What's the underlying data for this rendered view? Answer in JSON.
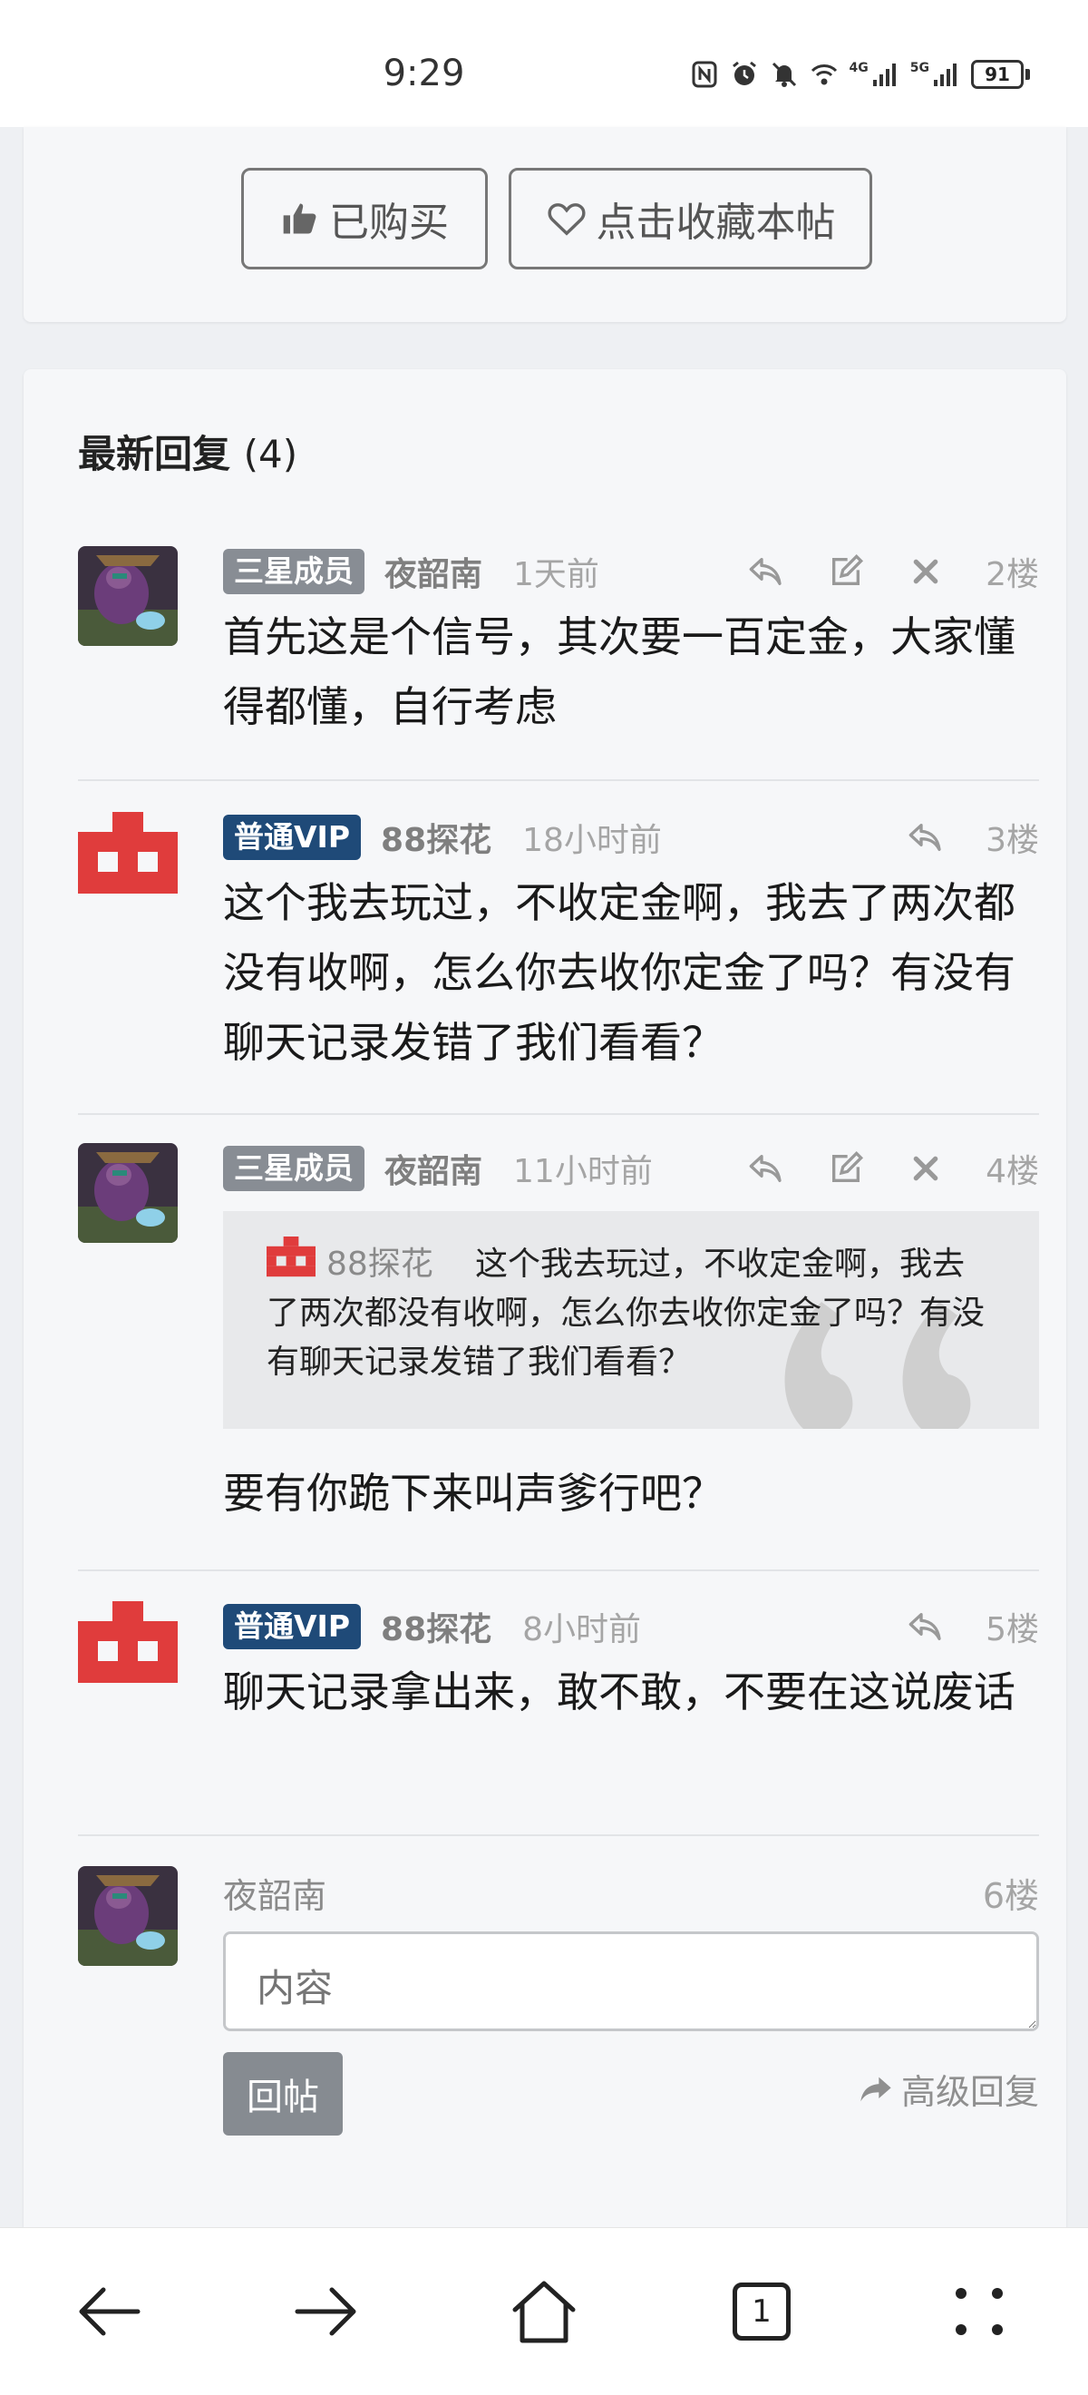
{
  "status_bar": {
    "time": "9:29",
    "battery": "91",
    "net_a": "4G",
    "net_b": "5G"
  },
  "top_card": {
    "bought_label": "已购买",
    "favorite_label": "点击收藏本帖"
  },
  "replies_section": {
    "title": "最新回复",
    "count": "(4)"
  },
  "posts": [
    {
      "badge": "三星成员",
      "user": "夜韶南",
      "time": "1天前",
      "floor": "2楼",
      "text": "首先这是个信号，其次要一百定金，大家懂得都懂，自行考虑"
    },
    {
      "badge": "普通VIP",
      "user": "88探花",
      "time": "18小时前",
      "floor": "3楼",
      "text": "这个我去玩过，不收定金啊，我去了两次都没有收啊，怎么你去收你定金了吗？有没有聊天记录发错了我们看看？"
    },
    {
      "badge": "三星成员",
      "user": "夜韶南",
      "time": "11小时前",
      "floor": "4楼",
      "quote_user": "88探花",
      "quote_text": "这个我去玩过，不收定金啊，我去了两次都没有收啊，怎么你去收你定金了吗？有没有聊天记录发错了我们看看？",
      "text": "要有你跪下来叫声爹行吧？"
    },
    {
      "badge": "普通VIP",
      "user": "88探花",
      "time": "8小时前",
      "floor": "5楼",
      "text": "聊天记录拿出来，敢不敢，不要在这说废话"
    }
  ],
  "reply_form": {
    "user": "夜韶南",
    "floor": "6楼",
    "placeholder": "内容",
    "submit_label": "回帖",
    "advanced_label": "高级回复"
  },
  "bottom_nav": {
    "tabs_count": "1"
  },
  "colors": {
    "badge_gray": "#888d94",
    "badge_navy": "#1f4a78",
    "vip_avatar_red": "#e03c3c",
    "page_bg": "#eef0f3"
  },
  "icons": [
    "nfc-icon",
    "alarm-icon",
    "mute-icon",
    "wifi-icon",
    "signal-icon",
    "battery-icon",
    "thumbs-up-icon",
    "heart-icon",
    "reply-icon",
    "edit-icon",
    "delete-icon",
    "share-arrow-icon",
    "back-icon",
    "forward-icon",
    "home-icon",
    "tabs-icon",
    "more-icon"
  ]
}
